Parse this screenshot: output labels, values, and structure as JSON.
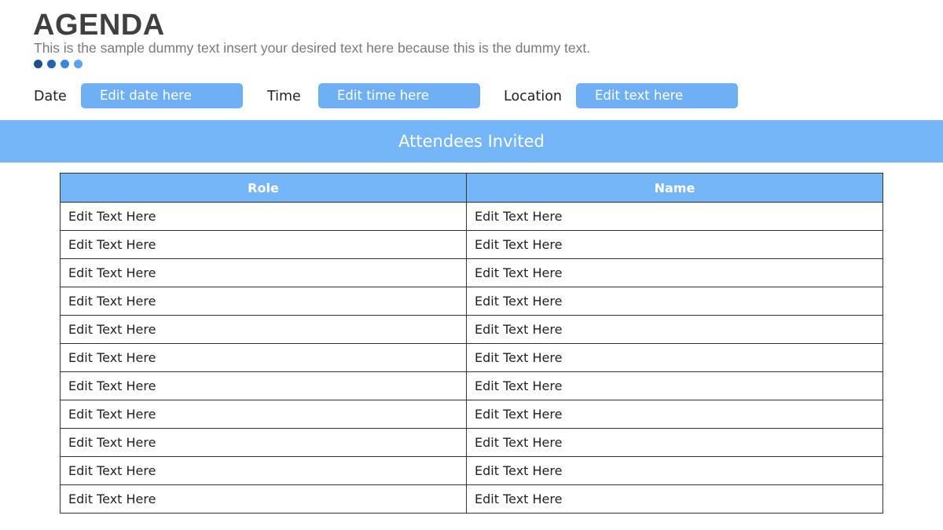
{
  "header": {
    "title": "AGENDA",
    "subtitle": "This is the sample dummy text insert your desired text here because this is the dummy text.",
    "dot_colors": [
      "#1f4e8c",
      "#2563b0",
      "#3a86e0",
      "#5aa5f0"
    ]
  },
  "fields": [
    {
      "label": "Date",
      "value": "Edit date here"
    },
    {
      "label": "Time",
      "value": "Edit time here"
    },
    {
      "label": "Location",
      "value": "Edit text here"
    }
  ],
  "section": {
    "title": "Attendees Invited"
  },
  "table": {
    "headers": [
      "Role",
      "Name"
    ],
    "rows": [
      [
        "Edit Text Here",
        "Edit Text Here"
      ],
      [
        "Edit Text Here",
        "Edit Text Here"
      ],
      [
        "Edit Text Here",
        "Edit Text Here"
      ],
      [
        "Edit Text Here",
        "Edit Text Here"
      ],
      [
        "Edit Text Here",
        "Edit Text Here"
      ],
      [
        "Edit Text Here",
        "Edit Text Here"
      ],
      [
        "Edit Text Here",
        "Edit Text Here"
      ],
      [
        "Edit Text Here",
        "Edit Text Here"
      ],
      [
        "Edit Text Here",
        "Edit Text Here"
      ],
      [
        "Edit Text Here",
        "Edit Text Here"
      ],
      [
        "Edit Text Here",
        "Edit Text Here"
      ]
    ]
  },
  "colors": {
    "accent": "#74b6f7",
    "field_box": "#6fb0f5"
  }
}
